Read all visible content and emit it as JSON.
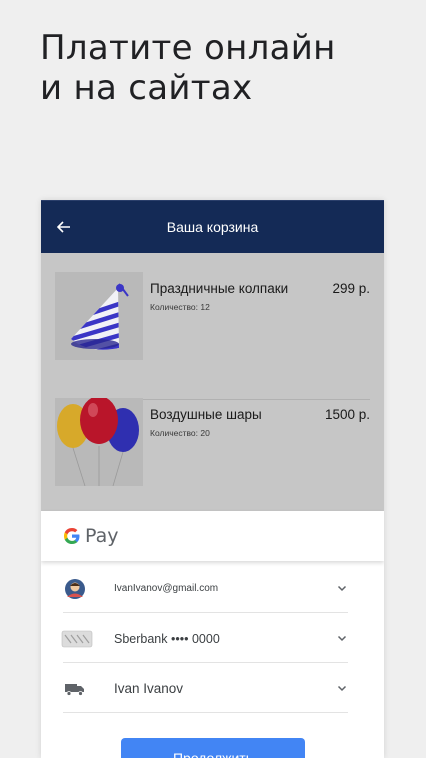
{
  "headline": {
    "line1": "Платите онлайн",
    "line2": "и на сайтах"
  },
  "appbar": {
    "title": "Ваша корзина",
    "back_icon": "arrow-back-icon",
    "background": "#142a56"
  },
  "cart": {
    "items": [
      {
        "name": "Праздничные колпаки",
        "price": "299 р.",
        "quantity": "Количество: 12",
        "image": "party-hat"
      },
      {
        "name": "Воздушные шары",
        "price": "1500 р.",
        "quantity": "Количество: 20",
        "image": "balloons"
      }
    ]
  },
  "gpay": {
    "logo_letter": "G",
    "logo_word": "Pay"
  },
  "payment_options": [
    {
      "icon": "avatar-icon",
      "label": "IvanIvanov@gmail.com"
    },
    {
      "icon": "card-icon",
      "label": "Sberbank •••• 0000"
    },
    {
      "icon": "truck-icon",
      "label": "Ivan Ivanov"
    }
  ],
  "continue_label": "Продолжить",
  "colors": {
    "accent": "#4285f4",
    "cart_overlay": "#c6c6c6"
  }
}
